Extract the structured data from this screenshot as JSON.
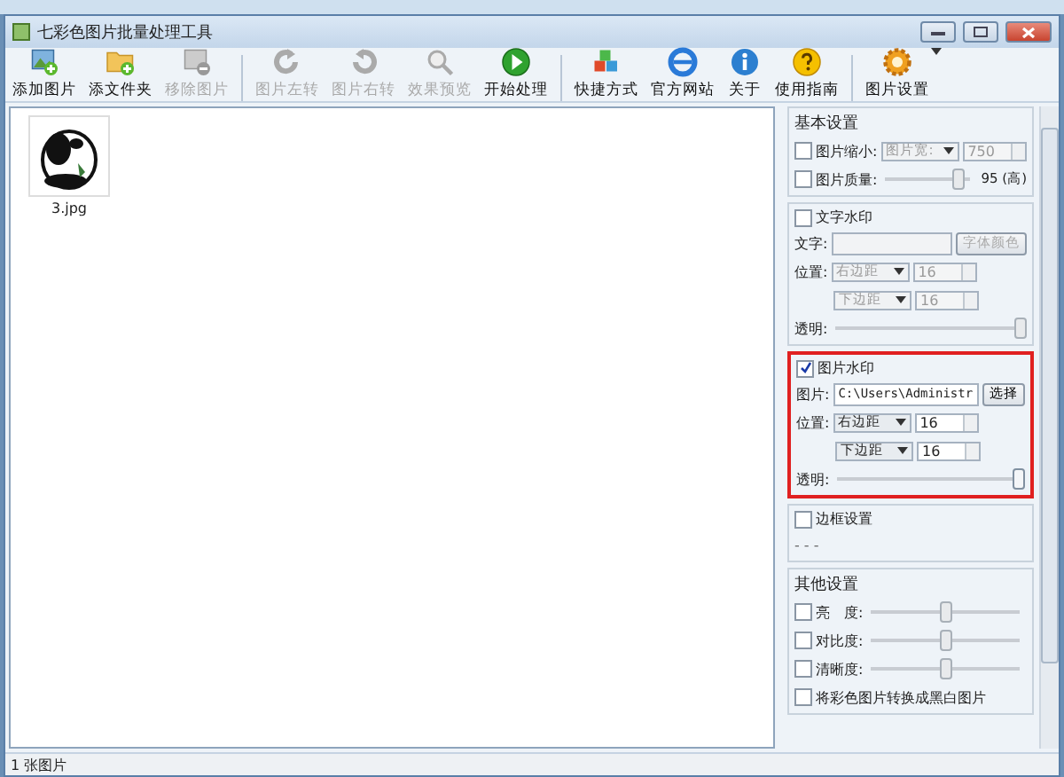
{
  "window": {
    "title": "七彩色图片批量处理工具"
  },
  "toolbar": [
    {
      "label": "添加图片",
      "disabled": false
    },
    {
      "label": "添文件夹",
      "disabled": false
    },
    {
      "label": "移除图片",
      "disabled": true
    },
    {
      "kind": "sep"
    },
    {
      "label": "图片左转",
      "disabled": true
    },
    {
      "label": "图片右转",
      "disabled": true
    },
    {
      "label": "效果预览",
      "disabled": true
    },
    {
      "label": "开始处理",
      "disabled": false
    },
    {
      "kind": "sep"
    },
    {
      "label": "快捷方式",
      "disabled": false
    },
    {
      "label": "官方网站",
      "disabled": false
    },
    {
      "label": "关于",
      "disabled": false
    },
    {
      "label": "使用指南",
      "disabled": false
    },
    {
      "kind": "sep"
    },
    {
      "label": "图片设置",
      "disabled": false,
      "dropdown": true
    }
  ],
  "files": [
    {
      "name": "3.jpg"
    }
  ],
  "panel": [
    {
      "title": "基本设置",
      "highlight": false,
      "rows": [
        [
          {
            "kind": "checkbox",
            "label": "图片缩小:",
            "checked": false
          },
          {
            "kind": "select",
            "value": "图片宽:",
            "disabled": true
          },
          {
            "kind": "spin",
            "value": "750",
            "disabled": true
          }
        ],
        [
          {
            "kind": "checkbox",
            "label": "图片质量:",
            "checked": false
          },
          {
            "kind": "slider",
            "level": 0.85,
            "disabled": true
          },
          {
            "kind": "reading",
            "text": "95 (高)"
          }
        ]
      ]
    },
    {
      "check": {
        "label": "文字水印",
        "checked": false
      },
      "highlight": false,
      "rows": [
        [
          {
            "kind": "label",
            "text": "文字:"
          },
          {
            "kind": "field",
            "disabled": true
          },
          {
            "kind": "button",
            "label": "字体颜色",
            "disabled": true
          }
        ],
        [
          {
            "kind": "label",
            "text": "位置:"
          },
          {
            "kind": "select",
            "value": "右边距",
            "disabled": true
          },
          {
            "kind": "spin",
            "value": "16",
            "disabled": true
          }
        ],
        [
          {
            "kind": "gap"
          },
          {
            "kind": "select",
            "value": "下边距",
            "disabled": true
          },
          {
            "kind": "spin",
            "value": "16",
            "disabled": true
          }
        ],
        [
          {
            "kind": "label",
            "text": "透明:"
          },
          {
            "kind": "slider",
            "level": 1,
            "disabled": true
          }
        ]
      ]
    },
    {
      "check": {
        "label": "图片水印",
        "checked": true
      },
      "highlight": true,
      "rows": [
        [
          {
            "kind": "label",
            "text": "图片:"
          },
          {
            "kind": "field",
            "value": "C:\\Users\\Administr",
            "disabled": false
          },
          {
            "kind": "button",
            "label": "选择",
            "disabled": false
          }
        ],
        [
          {
            "kind": "label",
            "text": "位置:"
          },
          {
            "kind": "select",
            "value": "右边距",
            "disabled": false
          },
          {
            "kind": "spin",
            "value": "16",
            "disabled": false
          }
        ],
        [
          {
            "kind": "gap"
          },
          {
            "kind": "select",
            "value": "下边距",
            "disabled": false
          },
          {
            "kind": "spin",
            "value": "16",
            "disabled": false
          }
        ],
        [
          {
            "kind": "label",
            "text": "透明:"
          },
          {
            "kind": "slider",
            "level": 1,
            "disabled": false
          }
        ]
      ]
    },
    {
      "check": {
        "label": "边框设置",
        "checked": false
      },
      "highlight": false,
      "rows": [
        [
          {
            "kind": "dashes",
            "text": "- - -"
          }
        ]
      ]
    },
    {
      "title": "其他设置",
      "highlight": false,
      "rows": [
        [
          {
            "kind": "checkbox",
            "label": "亮　度:",
            "checked": false
          },
          {
            "kind": "slider",
            "level": 0.5,
            "disabled": true
          }
        ],
        [
          {
            "kind": "checkbox",
            "label": "对比度:",
            "checked": false
          },
          {
            "kind": "slider",
            "level": 0.5,
            "disabled": true
          }
        ],
        [
          {
            "kind": "checkbox",
            "label": "清晰度:",
            "checked": false
          },
          {
            "kind": "slider",
            "level": 0.5,
            "disabled": true
          }
        ],
        [
          {
            "kind": "checkbox",
            "label": "将彩色图片转换成黑白图片",
            "checked": false
          }
        ]
      ]
    }
  ],
  "status_bar": {
    "text": "1 张图片"
  }
}
